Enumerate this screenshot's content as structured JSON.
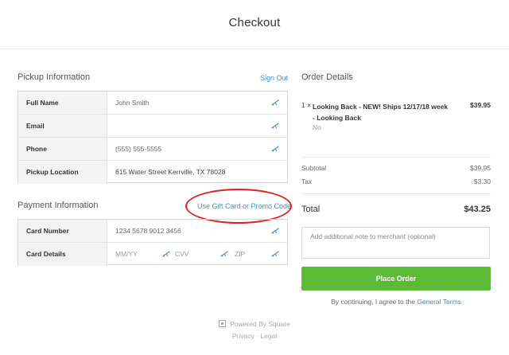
{
  "header": {
    "title": "Checkout"
  },
  "pickup": {
    "title": "Pickup Information",
    "sign_out": "Sign Out",
    "rows": [
      {
        "label": "Full Name",
        "value": "John Smith",
        "autofill": true
      },
      {
        "label": "Email",
        "value": "",
        "autofill": true
      },
      {
        "label": "Phone",
        "value": "(555) 555-5555",
        "autofill": true
      },
      {
        "label": "Pickup Location",
        "value": "615 Water Street Kerrville, TX 78028",
        "autofill": false
      }
    ]
  },
  "payment": {
    "title": "Payment Information",
    "promo_link": "Use Gift Card or Promo Code",
    "card_number_label": "Card Number",
    "card_number_value": "1234 5678 9012 3456",
    "card_details_label": "Card Details",
    "exp_placeholder": "MM/YY",
    "cvv_placeholder": "CVV",
    "zip_placeholder": "ZIP"
  },
  "order": {
    "title": "Order Details",
    "item": {
      "qty": "1 ×",
      "name": "Looking Back - NEW! Ships 12/17/18 week - Looking Back",
      "option": "No",
      "price": "$39.95"
    },
    "subtotal_label": "Subtotal",
    "subtotal_value": "$39.95",
    "tax_label": "Tax",
    "tax_value": "$3.30",
    "total_label": "Total",
    "total_value": "$43.25",
    "note_placeholder": "Add additional note to merchant (optional)",
    "place_order": "Place Order",
    "terms_text": "By continuing, I agree to the",
    "terms_link": "General Terms"
  },
  "footer": {
    "powered": "Powered By Square",
    "privacy": "Privacy",
    "separator": "·",
    "legal": "Legal"
  },
  "annotation": {
    "color": "#e02020"
  },
  "colors": {
    "accent": "#3e8ed0",
    "button": "#5bbb37"
  },
  "icons": {
    "autofill": "autofill-key-icon",
    "square_logo": "square-logo-icon"
  }
}
